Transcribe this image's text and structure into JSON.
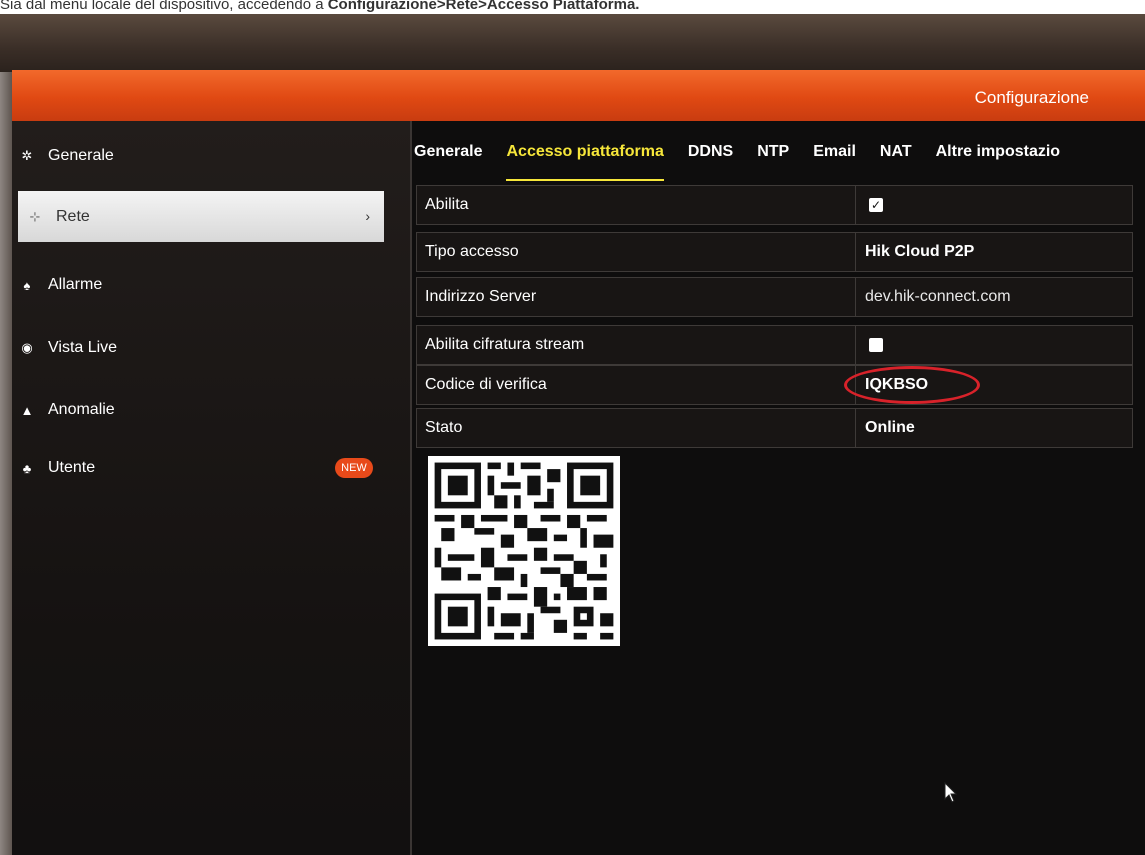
{
  "caption": {
    "text_prefix": "Sia dal menù locale del dispositivo, accedendo a ",
    "text_bold": "Configurazione>Rete>Accesso Piattaforma."
  },
  "window": {
    "title": "Configurazione",
    "accent_color": "#e04913"
  },
  "sidebar": {
    "items": [
      {
        "label": "Generale",
        "icon": "gear-icon"
      },
      {
        "label": "Rete",
        "icon": "network-icon"
      },
      {
        "label": "Allarme",
        "icon": "alarm-icon"
      },
      {
        "label": "Vista Live",
        "icon": "eye-icon"
      },
      {
        "label": "Anomalie",
        "icon": "warning-icon"
      },
      {
        "label": "Utente",
        "icon": "users-icon"
      }
    ],
    "active_item": "Rete",
    "new_badge": "NEW"
  },
  "tabs": {
    "items": [
      "Generale",
      "Accesso piattaforma",
      "DDNS",
      "NTP",
      "Email",
      "NAT",
      "Altre impostazio"
    ],
    "active": "Accesso piattaforma"
  },
  "form": {
    "abilita": {
      "label": "Abilita",
      "checked": true
    },
    "tipo_accesso": {
      "label": "Tipo accesso",
      "value": "Hik Cloud P2P"
    },
    "indirizzo_server": {
      "label": "Indirizzo Server",
      "value": "dev.hik-connect.com"
    },
    "cifratura": {
      "label": "Abilita cifratura stream",
      "checked": false
    },
    "codice_verifica": {
      "label": "Codice di verifica",
      "value": "IQKBSO"
    },
    "stato": {
      "label": "Stato",
      "value": "Online"
    }
  },
  "highlight_color": "#d8222a"
}
